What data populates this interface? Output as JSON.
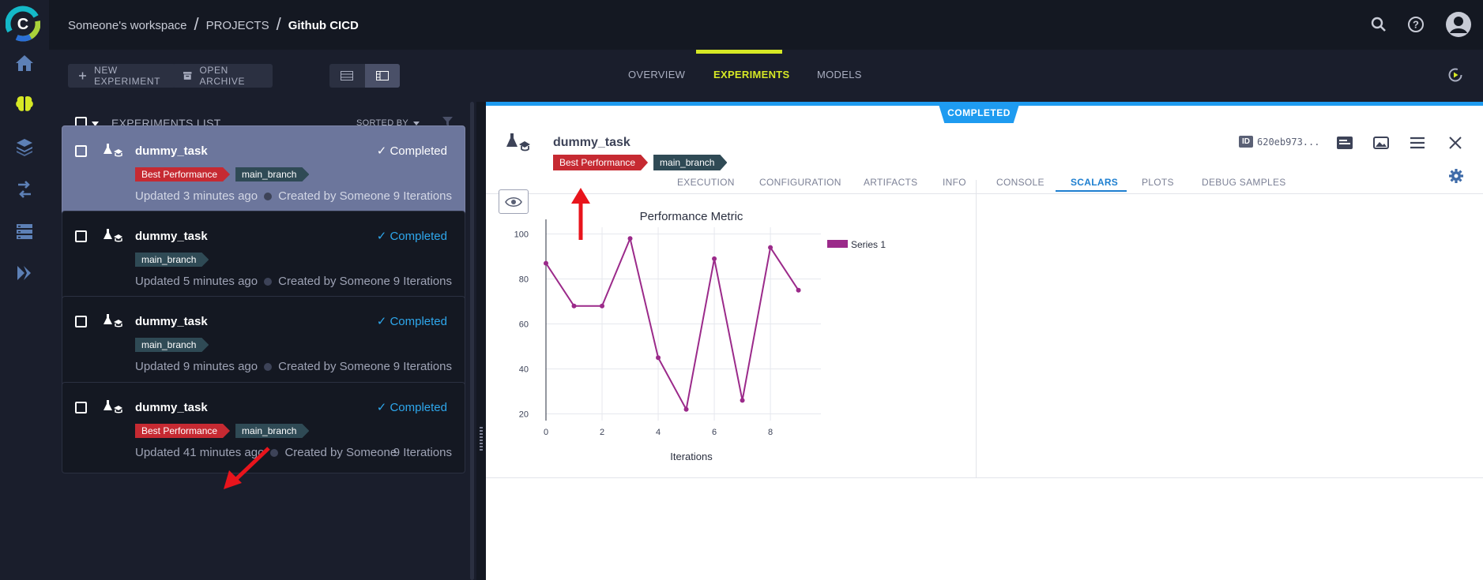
{
  "breadcrumb": {
    "workspace": "Someone's workspace",
    "projects": "PROJECTS",
    "current": "Github CICD"
  },
  "toolbar": {
    "new_experiment": "NEW EXPERIMENT",
    "open_archive": "OPEN ARCHIVE"
  },
  "main_tabs": [
    "OVERVIEW",
    "EXPERIMENTS",
    "MODELS"
  ],
  "list": {
    "title": "EXPERIMENTS LIST",
    "sorted_by": "SORTED BY",
    "items": [
      {
        "name": "dummy_task",
        "status": "Completed",
        "tags": [
          "Best Performance",
          "main_branch"
        ],
        "updated": "Updated 3 minutes ago",
        "created": "Created by Someone",
        "iterations": "9 Iterations"
      },
      {
        "name": "dummy_task",
        "status": "Completed",
        "tags": [
          "main_branch"
        ],
        "updated": "Updated 5 minutes ago",
        "created": "Created by Someone",
        "iterations": "9 Iterations"
      },
      {
        "name": "dummy_task",
        "status": "Completed",
        "tags": [
          "main_branch"
        ],
        "updated": "Updated 9 minutes ago",
        "created": "Created by Someone",
        "iterations": "9 Iterations"
      },
      {
        "name": "dummy_task",
        "status": "Completed",
        "tags": [
          "Best Performance",
          "main_branch"
        ],
        "updated": "Updated 41 minutes ago",
        "created": "Created by Someone",
        "iterations": "9 Iterations"
      }
    ]
  },
  "details": {
    "status_badge": "COMPLETED",
    "name": "dummy_task",
    "tags": [
      "Best Performance",
      "main_branch"
    ],
    "id_label": "ID",
    "id_value": "620eb973...",
    "tabs": [
      "EXECUTION",
      "CONFIGURATION",
      "ARTIFACTS",
      "INFO",
      "CONSOLE",
      "SCALARS",
      "PLOTS",
      "DEBUG SAMPLES"
    ],
    "active_tab": "SCALARS"
  },
  "chart_data": {
    "type": "line",
    "title": "Performance Metric",
    "xlabel": "Iterations",
    "ylabel": "",
    "x": [
      0,
      1,
      2,
      3,
      4,
      5,
      6,
      7,
      8,
      9
    ],
    "series": [
      {
        "name": "Series 1",
        "values": [
          87,
          68,
          68,
          98,
          45,
          22,
          89,
          26,
          94,
          75
        ],
        "color": "#9b2a8a"
      }
    ],
    "xticks": [
      0,
      2,
      4,
      6,
      8
    ],
    "yticks": [
      20,
      40,
      60,
      80,
      100
    ],
    "xlim": [
      0,
      9.8
    ],
    "ylim": [
      17,
      103
    ],
    "grid": true,
    "legend": "right"
  },
  "colors": {
    "accent": "#d6e825",
    "completed": "#1e9bf0",
    "tag_red": "#c62a32",
    "tag_dark": "#2f4a55",
    "arrow": "#e8141c"
  }
}
